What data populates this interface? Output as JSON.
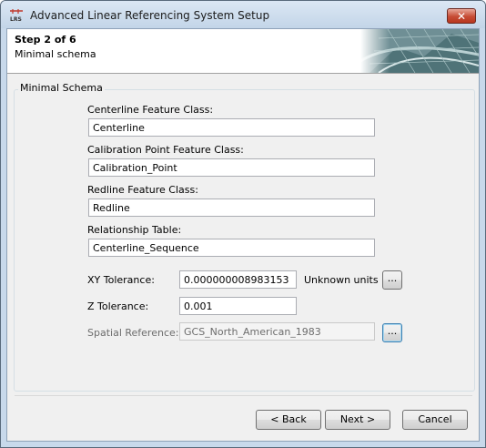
{
  "window": {
    "title": "Advanced Linear Referencing System Setup",
    "app_icon": "lrs-icon",
    "close_glyph": "✕"
  },
  "header": {
    "step": "Step 2 of 6",
    "subtitle": "Minimal schema"
  },
  "group": {
    "title": "Minimal Schema",
    "centerline_label": "Centerline Feature Class:",
    "centerline_value": "Centerline",
    "calibration_label": "Calibration Point Feature Class:",
    "calibration_value": "Calibration_Point",
    "redline_label": "Redline Feature Class:",
    "redline_value": "Redline",
    "relationship_label": "Relationship Table:",
    "relationship_value": "Centerline_Sequence",
    "xy_label": "XY Tolerance:",
    "xy_value": "0.000000008983153",
    "units": "Unknown units",
    "z_label": "Z Tolerance:",
    "z_value": "0.001",
    "spatial_label": "Spatial Reference:",
    "spatial_value": "GCS_North_American_1983",
    "browse_label": "..."
  },
  "footer": {
    "back": "< Back",
    "next": "Next >",
    "cancel": "Cancel"
  }
}
